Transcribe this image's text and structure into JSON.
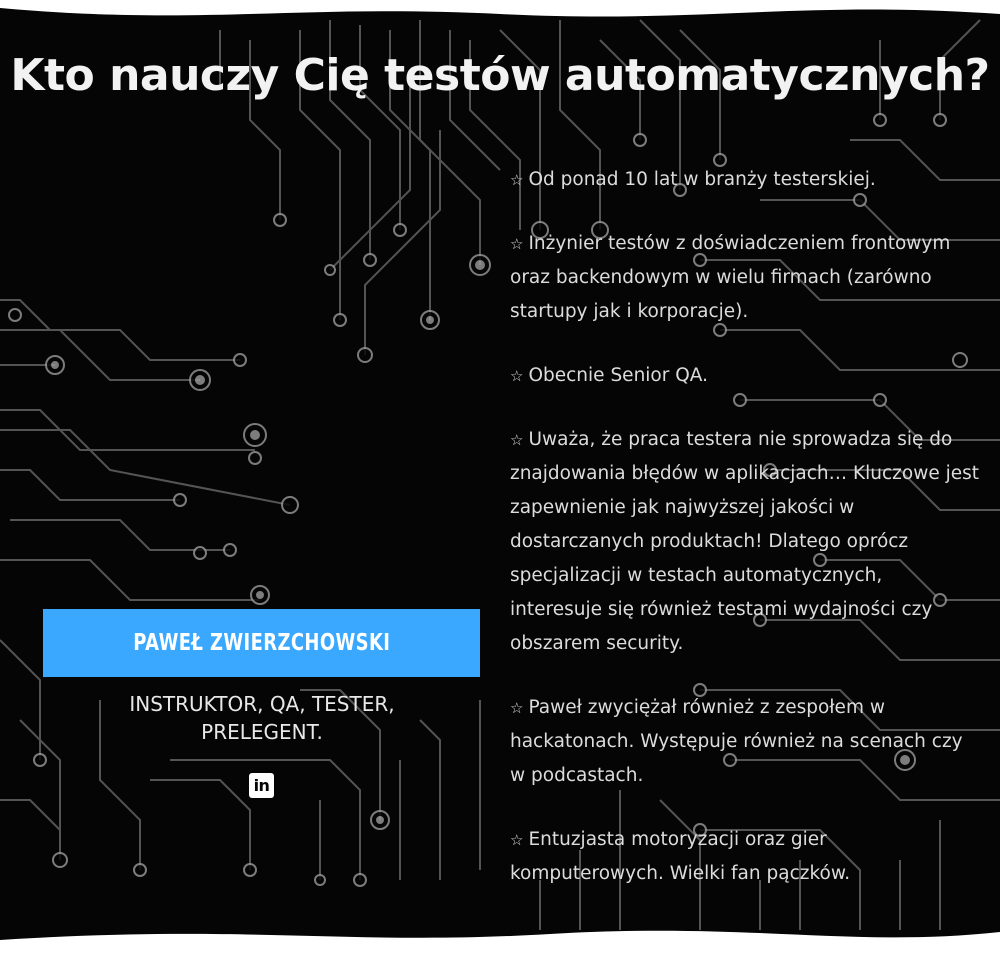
{
  "heading": "Kto nauczy Cię testów automatycznych?",
  "instructor": {
    "name": "PAWEŁ ZWIERZCHOWSKI",
    "role": "INSTRUKTOR, QA, TESTER, PRELEGENT.",
    "social_icon": "linkedin-icon",
    "social_label": "in"
  },
  "bio": {
    "bullet_icon": "star-outline-icon",
    "bullet_glyph": "☆",
    "items": [
      "Od ponad 10 lat w branży testerskiej.",
      "Inżynier testów z doświadczeniem frontowym oraz backendowym w wielu firmach (zarówno startupy jak i korporacje).",
      "Obecnie Senior QA.",
      "Uważa, że praca testera nie sprowadza się do znajdowania błędów w aplikacjach… Kluczowe jest  zapewnienie jak najwyższej jakości w dostarczanych produktach! Dlatego oprócz specjalizacji w testach automatycznych, interesuje się również testami wydajności czy obszarem security.",
      "Paweł zwyciężał również z zespołem w hackatonach. Występuje również na scenach czy w podcastach.",
      "Entuzjasta motoryzacji oraz gier komputerowych. Wielki fan pączków."
    ]
  },
  "colors": {
    "background": "#050505",
    "accent": "#3aa8ff",
    "text": "#e8e8e8",
    "circuit": "#8a8a8a"
  }
}
